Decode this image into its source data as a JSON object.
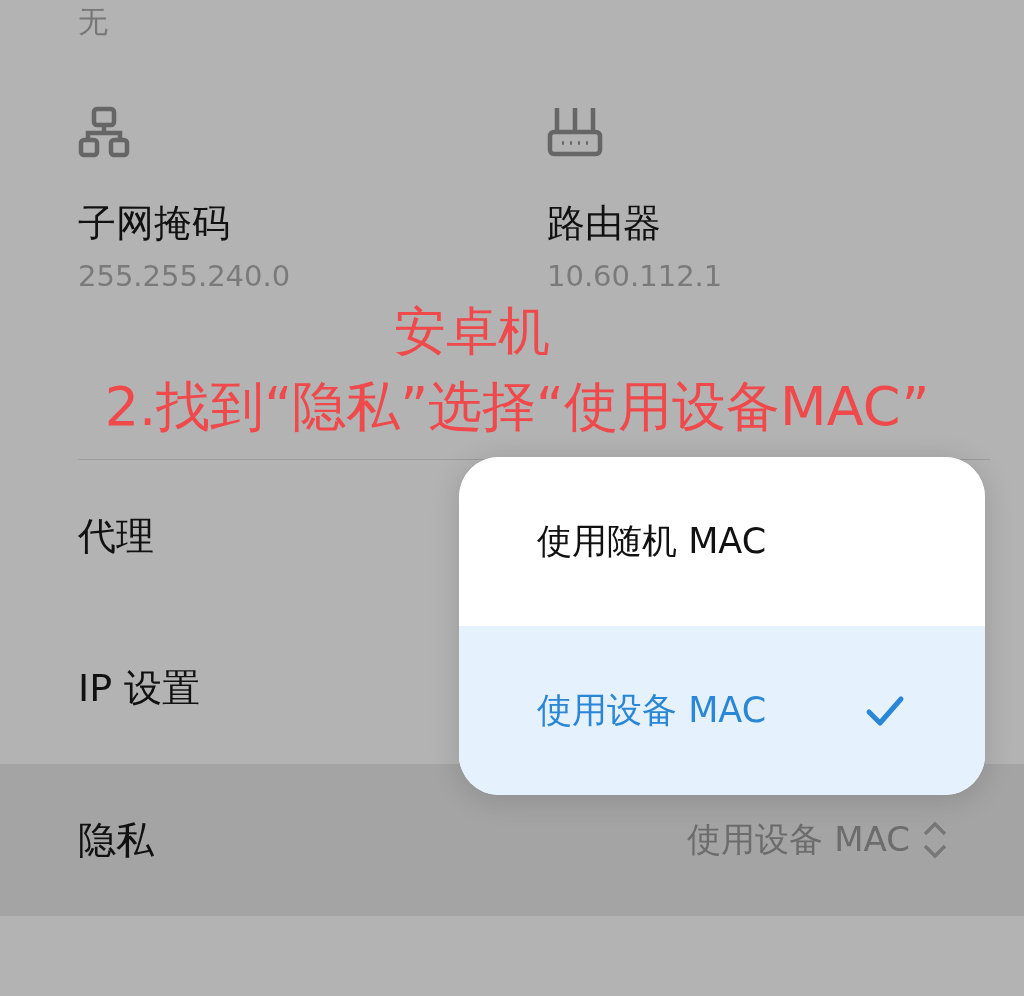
{
  "top_value": "无",
  "info": [
    {
      "kind": "subnet",
      "label": "子网掩码",
      "value": "255.255.240.0"
    },
    {
      "kind": "router",
      "label": "路由器",
      "value": "10.60.112.1"
    }
  ],
  "annotation": {
    "title": "安卓机",
    "instruction": "2.找到“隐私”选择“使用设备MAC”"
  },
  "rows": [
    {
      "label": "代理",
      "highlighted": false
    },
    {
      "label": "IP 设置",
      "highlighted": false
    },
    {
      "label": "隐私",
      "value": "使用设备 MAC",
      "highlighted": true
    }
  ],
  "popup": {
    "options": [
      {
        "label": "使用随机 MAC",
        "selected": false
      },
      {
        "label": "使用设备 MAC",
        "selected": true
      }
    ]
  }
}
